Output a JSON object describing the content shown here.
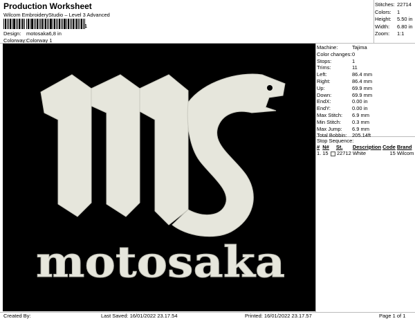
{
  "header": {
    "title": "Production Worksheet",
    "subtitle": "Wilcom EmbroideryStudio – Level 3 Advanced",
    "barcode_mark": "1"
  },
  "design_meta": {
    "design_label": "Design:",
    "design_value": "motosaka6,8 in",
    "colorway_label": "Colorway:",
    "colorway_value": "Colorway 1"
  },
  "summary": [
    {
      "label": "Stitches:",
      "value": "22714"
    },
    {
      "label": "Colors:",
      "value": "1"
    },
    {
      "label": "Height:",
      "value": "5.50 in"
    },
    {
      "label": "Width:",
      "value": "6.80 in"
    },
    {
      "label": "Zoom:",
      "value": "1:1"
    }
  ],
  "design_text": {
    "monogram": "ms",
    "wordmark": "motosaka",
    "thread_color": "#e6e6dc",
    "background_color": "#000000"
  },
  "machine_info": [
    {
      "label": "Machine:",
      "value": "Tajima"
    },
    {
      "label": "Color changes:",
      "value": "0"
    },
    {
      "label": "Stops:",
      "value": "1"
    },
    {
      "label": "Trims:",
      "value": "11"
    },
    {
      "label": "Left:",
      "value": "86.4 mm"
    },
    {
      "label": "Right:",
      "value": "86.4 mm"
    },
    {
      "label": "Up:",
      "value": "69.9 mm"
    },
    {
      "label": "Down:",
      "value": "69.9 mm"
    },
    {
      "label": "EndX:",
      "value": "0.00 in"
    },
    {
      "label": "EndY:",
      "value": "0.00 in"
    },
    {
      "label": "Max Stitch:",
      "value": "6.9 mm"
    },
    {
      "label": "Min Stitch:",
      "value": "0.3 mm"
    },
    {
      "label": "Max Jump:",
      "value": "6.9 mm"
    },
    {
      "label": "Total Bobbin:",
      "value": "205.14ft"
    }
  ],
  "stop_sequence": {
    "heading": "Stop Sequence:",
    "columns": [
      "#",
      "N#",
      "St.",
      "Description",
      "Code",
      "Brand"
    ],
    "rows": [
      {
        "num": "1.",
        "needle": "15",
        "stitches": "22712",
        "description": "White",
        "code": "15",
        "brand": "Wilcom"
      }
    ]
  },
  "footer": {
    "created_by": "Created By:",
    "last_saved": "Last Saved: 16/01/2022 23.17.54",
    "printed": "Printed: 16/01/2022 23.17.57",
    "page": "Page 1 of 1"
  }
}
